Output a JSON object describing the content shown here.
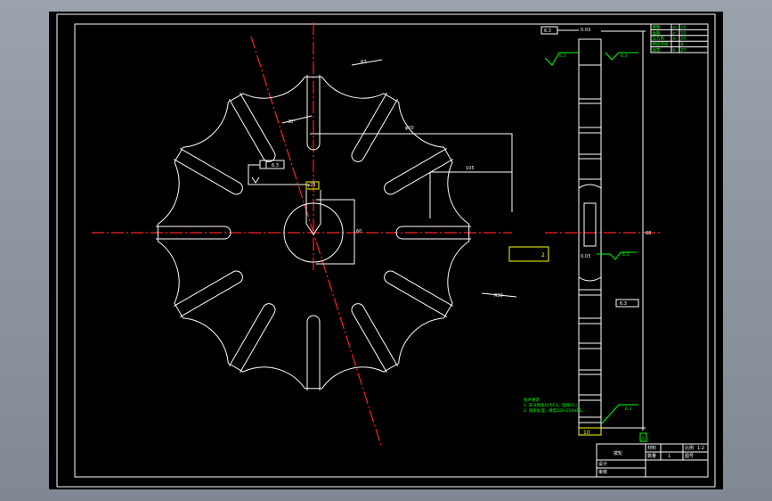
{
  "drawing": {
    "colors": {
      "background": "#000000",
      "lines": "#ffffff",
      "dimensions": "#ffff00",
      "center_lines": "#ff2020",
      "notes": "#00ff00"
    },
    "dims": {
      "d_tooth_top": "R3",
      "d_angle": "30°",
      "d_center_w": "φ20",
      "d_center_h": "105",
      "d_inner": "φ25",
      "d_bore": "60",
      "d_right_w": "2",
      "d_side_r": "R30",
      "d_fcf": "6.3",
      "d_side_h": "82"
    },
    "side_view": {
      "tol_label": "6.3",
      "top_dim": "0.03",
      "rough_left": "6.3",
      "rough_right": "6.3",
      "hub_dim": "0.03",
      "hub_rough": "6.3",
      "mid_tol": "6.3",
      "bottom_rough": "6.3",
      "bottom_dim": "10",
      "datum": "A",
      "height_dim": "68"
    },
    "param_table": [
      [
        "模数",
        "m",
        "10"
      ],
      [
        "齿数",
        "z",
        "10"
      ],
      [
        "压力角",
        "α",
        "20"
      ],
      [
        "精度等级",
        "",
        "8"
      ],
      [
        "齿宽",
        "b",
        "27"
      ]
    ],
    "notes": {
      "title": "技术要求",
      "line1": "1. 未注倒角均为C1，圆角R1；",
      "line2": "2. 调质处理，硬度220-250HBS。"
    },
    "title_block": {
      "part_name": "拨轮",
      "scale_label": "比例",
      "scale_value": "1:2",
      "qty_label": "数量",
      "qty_value": "1",
      "material_label": "材料",
      "drawing_no": "图号",
      "designer": "设计",
      "checker": "审核"
    }
  }
}
